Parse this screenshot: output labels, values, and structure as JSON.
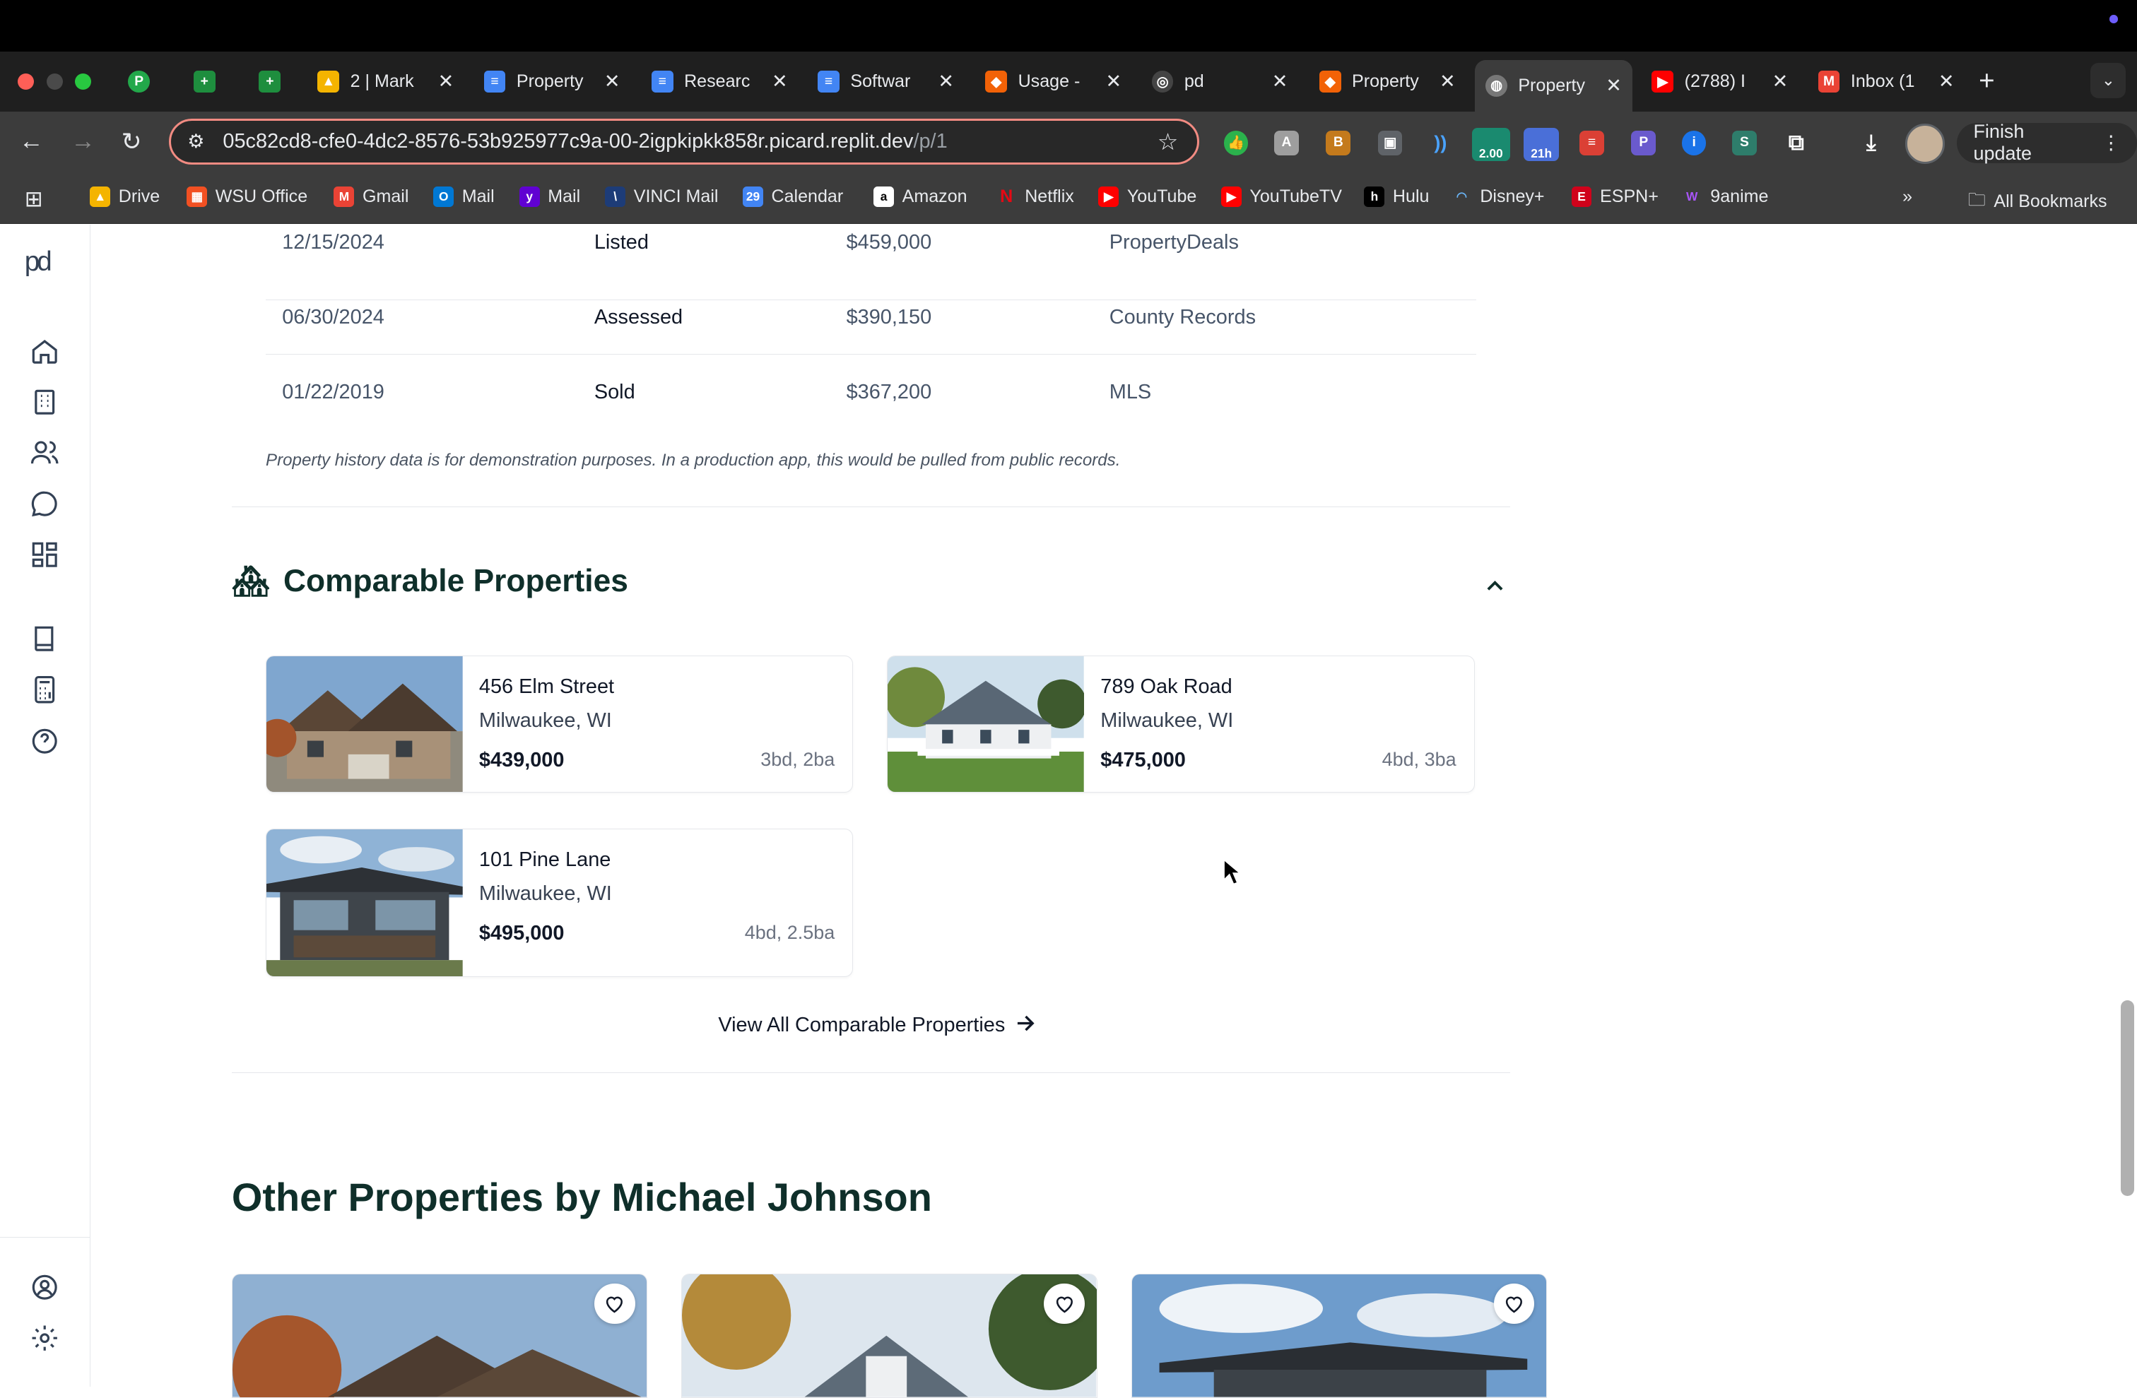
{
  "browser": {
    "tabs": [
      {
        "title": "",
        "favicon": "pushbullet-icon",
        "color": "#22a84a"
      },
      {
        "title": "",
        "favicon": "sheets-icon",
        "color": "#1e8e3e"
      },
      {
        "title": "",
        "favicon": "sheets-icon",
        "color": "#1e8e3e"
      },
      {
        "title": "2 | Mark",
        "favicon": "drive-icon",
        "color": "#f4b400"
      },
      {
        "title": "Property",
        "favicon": "docs-icon",
        "color": "#4285f4"
      },
      {
        "title": "Researc",
        "favicon": "docs-icon",
        "color": "#4285f4"
      },
      {
        "title": "Softwar",
        "favicon": "docs-icon",
        "color": "#4285f4"
      },
      {
        "title": "Usage -",
        "favicon": "replit-icon",
        "color": "#f26207"
      },
      {
        "title": "pd",
        "favicon": "openai-icon",
        "color": "#444"
      },
      {
        "title": "Property",
        "favicon": "replit-icon",
        "color": "#f26207"
      },
      {
        "title": "Property",
        "favicon": "globe-icon",
        "color": "#777"
      },
      {
        "title": "(2788) I",
        "favicon": "youtube-icon",
        "color": "#ff0000"
      },
      {
        "title": "Inbox (1",
        "favicon": "gmail-icon",
        "color": "#ea4335"
      }
    ],
    "url_main": "05c82cd8-cfe0-4dc2-8576-53b925977c9a-00-2igpkipkk858r.picard.replit.dev",
    "url_path": "/p/1",
    "finish_update": "Finish update",
    "ext_badge_1": "2.00",
    "ext_badge_2": "21h",
    "bookmarks": [
      "Drive",
      "WSU Office",
      "Gmail",
      "Mail",
      "Mail",
      "VINCI Mail",
      "Calendar",
      "Amazon",
      "Netflix",
      "YouTube",
      "YouTubeTV",
      "Hulu",
      "Disney+",
      "ESPN+",
      "9anime"
    ],
    "all_bookmarks": "All Bookmarks"
  },
  "app": {
    "logo": "pd",
    "history": [
      {
        "date": "12/15/2024",
        "event": "Listed",
        "price": "$459,000",
        "source": "PropertyDeals"
      },
      {
        "date": "06/30/2024",
        "event": "Assessed",
        "price": "$390,150",
        "source": "County Records"
      },
      {
        "date": "01/22/2019",
        "event": "Sold",
        "price": "$367,200",
        "source": "MLS"
      }
    ],
    "history_note": "Property history data is for demonstration purposes. In a production app, this would be pulled from public records.",
    "comparables_title": "Comparable Properties",
    "comparables": [
      {
        "address": "456 Elm Street",
        "city": "Milwaukee, WI",
        "price": "$439,000",
        "beds": "3bd, 2ba"
      },
      {
        "address": "789 Oak Road",
        "city": "Milwaukee, WI",
        "price": "$475,000",
        "beds": "4bd, 3ba"
      },
      {
        "address": "101 Pine Lane",
        "city": "Milwaukee, WI",
        "price": "$495,000",
        "beds": "4bd, 2.5ba"
      }
    ],
    "view_all": "View All Comparable Properties",
    "other_title": "Other Properties by Michael Johnson"
  }
}
